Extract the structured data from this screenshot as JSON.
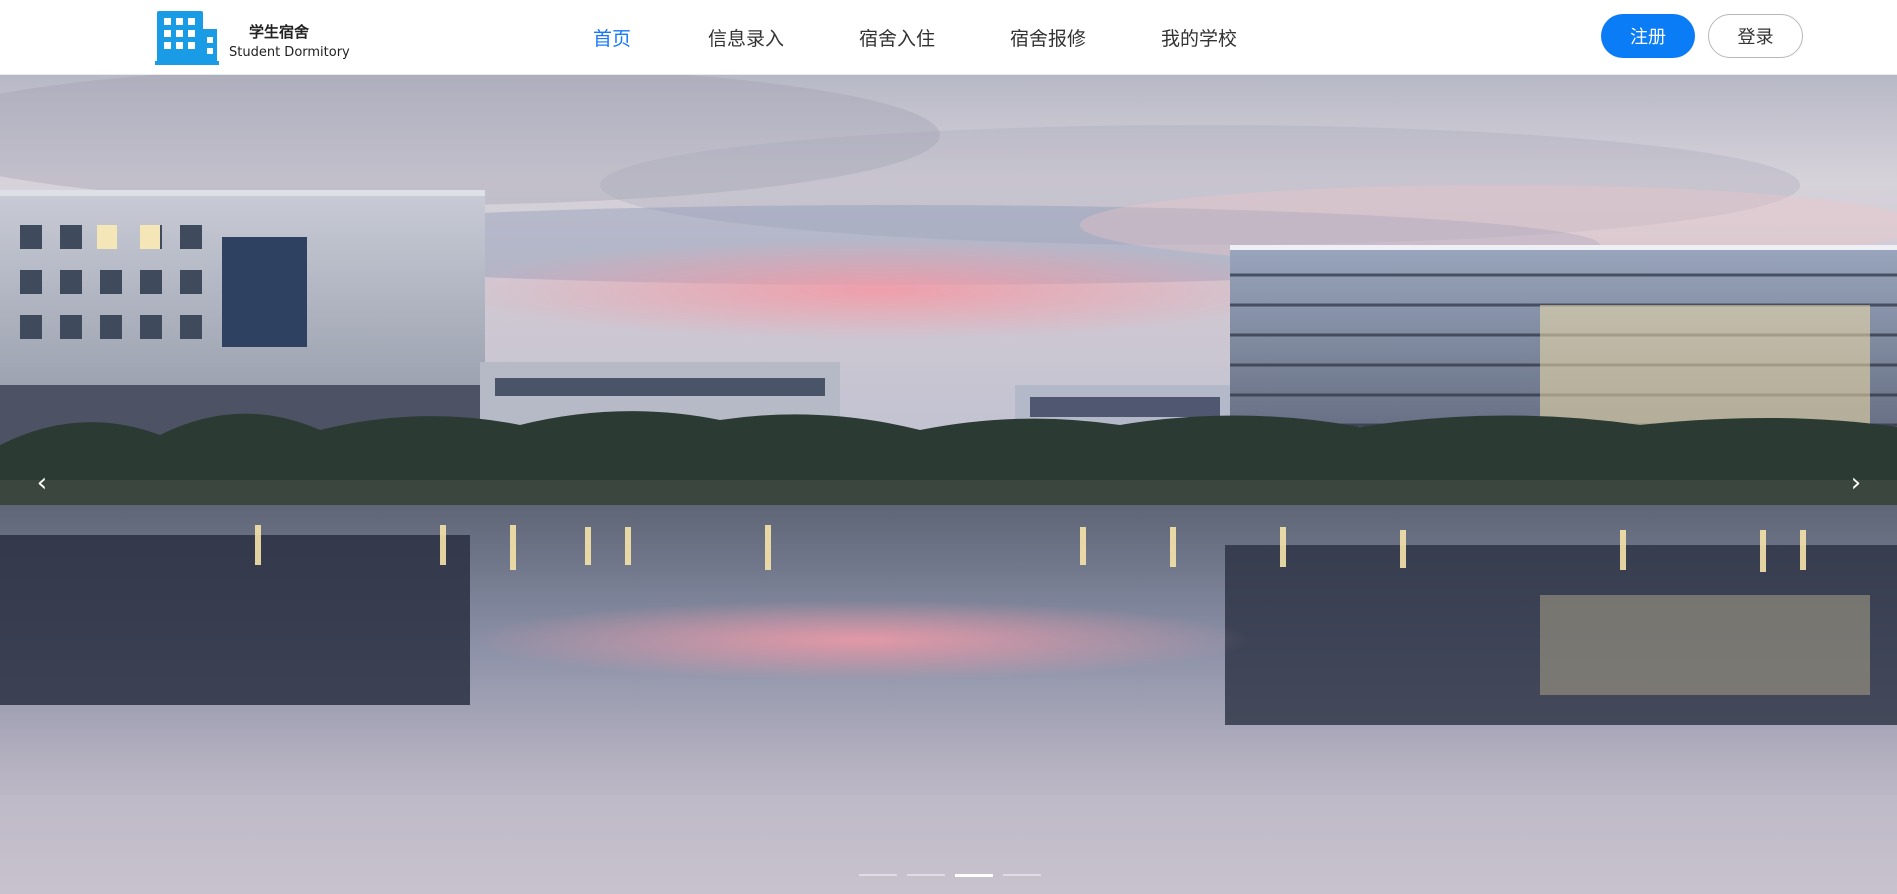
{
  "brand": {
    "name_cn": "学生宿舍",
    "name_en": "Student Dormitory",
    "icon": "building-icon",
    "icon_color": "#1a9be6"
  },
  "nav": {
    "items": [
      {
        "label": "首页",
        "active": true
      },
      {
        "label": "信息录入",
        "active": false
      },
      {
        "label": "宿舍入住",
        "active": false
      },
      {
        "label": "宿舍报修",
        "active": false
      },
      {
        "label": "我的学校",
        "active": false
      }
    ],
    "active_color": "#1677ff"
  },
  "auth": {
    "register_label": "注册",
    "login_label": "登录",
    "register_color": "#0a7cf5"
  },
  "carousel": {
    "prev_icon": "chevron-left-icon",
    "next_icon": "chevron-right-icon",
    "prev_glyph": "‹",
    "next_glyph": "›",
    "slide_count": 4,
    "active_slide": 3
  }
}
